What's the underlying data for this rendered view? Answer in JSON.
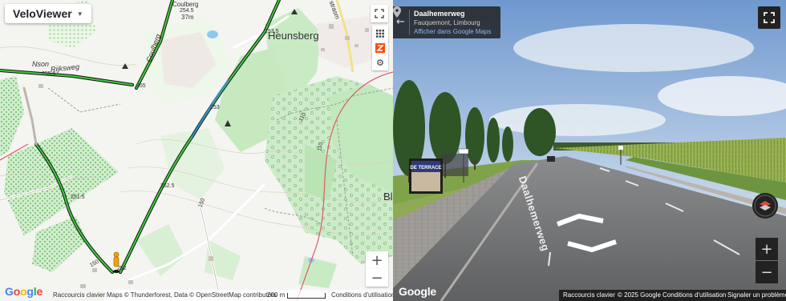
{
  "map": {
    "app_title": "VeloViewer",
    "place_label": "Heunsberg",
    "place_label_right": "Bl",
    "street_rijksweg": "Rijksweg",
    "street_nson": "Nson",
    "street_coulberg": "Coulberg",
    "street_top": "Coulberg",
    "street_top2": "strasm",
    "elevation_labels": [
      "254.5",
      "37m",
      "253.5",
      "255.5",
      "255",
      "253",
      "252.5",
      "251.5",
      "252",
      "110",
      "110",
      "150",
      "150"
    ],
    "zoom_in": "+",
    "zoom_out": "−",
    "controls": [
      "fullscreen-icon",
      "grid-icon",
      "strava-icon",
      "gear-icon"
    ],
    "footer": {
      "shortcuts": "Raccourcis clavier",
      "attribution": "Maps © Thunderforest, Data © OpenStreetMap contributors",
      "scale": "200 m",
      "terms": "Conditions d'utilisation"
    },
    "google": [
      "G",
      "o",
      "o",
      "g",
      "l",
      "e"
    ]
  },
  "streetview": {
    "title": "Daalhemerweg",
    "subtitle": "Fauquemont, Limbourg",
    "link": "Afficher dans Google Maps",
    "back": "←",
    "road_name": "Daalhemerweg",
    "zoom_in": "+",
    "zoom_out": "−",
    "google": "Google",
    "footer": {
      "shortcuts": "Raccourcis clavier",
      "copyright": "© 2025 Google",
      "terms": "Conditions d'utilisation",
      "report": "Signaler un problème"
    },
    "billboard": "DE TERRACE"
  },
  "colors": {
    "route_green": "#3ecf3e",
    "route_blue": "#2c8fd6",
    "forest": "#b9e6b5",
    "water": "#8fc9f0",
    "sky_top": "#6f98cf",
    "road": "#6d6f72"
  }
}
